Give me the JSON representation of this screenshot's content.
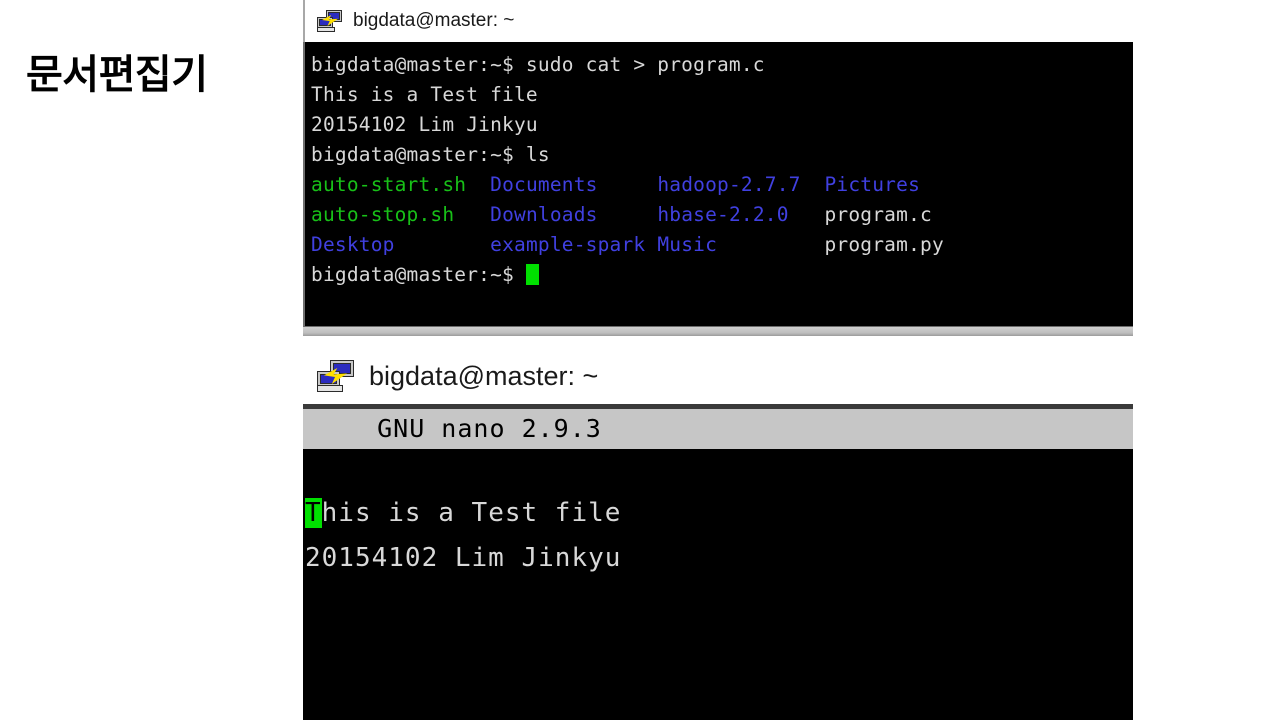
{
  "slide": {
    "heading": "문서편집기"
  },
  "colors": {
    "terminal_background": "#000000",
    "terminal_foreground": "#d8d8d8",
    "dir_blue": "#4040e0",
    "exec_green": "#18c018",
    "cursor_green": "#00e000",
    "nano_titlebar_background": "#c6c6c6",
    "nano_titlebar_foreground": "#000000",
    "window_titlebar_background": "#ffffff"
  },
  "window_top": {
    "icon": "putty-icon",
    "title": "bigdata@master: ~",
    "lines": [
      {
        "id": "cmd-cat",
        "segments": [
          {
            "text": "bigdata@master:~$ sudo cat > program.c",
            "color": "white"
          }
        ]
      },
      {
        "id": "heredoc-line-1",
        "segments": [
          {
            "text": "This is a Test file",
            "color": "white"
          }
        ]
      },
      {
        "id": "heredoc-line-2",
        "segments": [
          {
            "text": "20154102 Lim Jinkyu",
            "color": "white"
          }
        ]
      },
      {
        "id": "cmd-ls",
        "segments": [
          {
            "text": "bigdata@master:~$ ls",
            "color": "white"
          }
        ]
      },
      {
        "id": "ls-row-1",
        "segments": [
          {
            "text": "auto-start.sh",
            "color": "green"
          },
          {
            "text": "  ",
            "color": "white"
          },
          {
            "text": "Documents    ",
            "color": "blue"
          },
          {
            "text": " ",
            "color": "white"
          },
          {
            "text": "hadoop-2.7.7",
            "color": "blue"
          },
          {
            "text": "  ",
            "color": "white"
          },
          {
            "text": "Pictures",
            "color": "blue"
          }
        ]
      },
      {
        "id": "ls-row-2",
        "segments": [
          {
            "text": "auto-stop.sh ",
            "color": "green"
          },
          {
            "text": "  ",
            "color": "white"
          },
          {
            "text": "Downloads    ",
            "color": "blue"
          },
          {
            "text": " ",
            "color": "white"
          },
          {
            "text": "hbase-2.2.0 ",
            "color": "blue"
          },
          {
            "text": "  ",
            "color": "white"
          },
          {
            "text": "program.c",
            "color": "white"
          }
        ]
      },
      {
        "id": "ls-row-3",
        "segments": [
          {
            "text": "Desktop      ",
            "color": "blue"
          },
          {
            "text": "  ",
            "color": "white"
          },
          {
            "text": "example-spark",
            "color": "blue"
          },
          {
            "text": " ",
            "color": "white"
          },
          {
            "text": "Music       ",
            "color": "blue"
          },
          {
            "text": "  ",
            "color": "white"
          },
          {
            "text": "program.py",
            "color": "white"
          }
        ]
      },
      {
        "id": "prompt-idle",
        "segments": [
          {
            "text": "bigdata@master:~$ ",
            "color": "white"
          }
        ],
        "cursor": true
      }
    ]
  },
  "window_nano": {
    "icon": "putty-icon",
    "title": "bigdata@master: ~",
    "editor": {
      "titlebar": "  GNU nano 2.9.3",
      "cursor_char": "T",
      "lines": [
        {
          "id": "nano-line-1",
          "cursor_head": "T",
          "rest": "his is a Test file"
        },
        {
          "id": "nano-line-2",
          "cursor_head": "",
          "rest": "20154102 Lim Jinkyu"
        }
      ]
    }
  }
}
